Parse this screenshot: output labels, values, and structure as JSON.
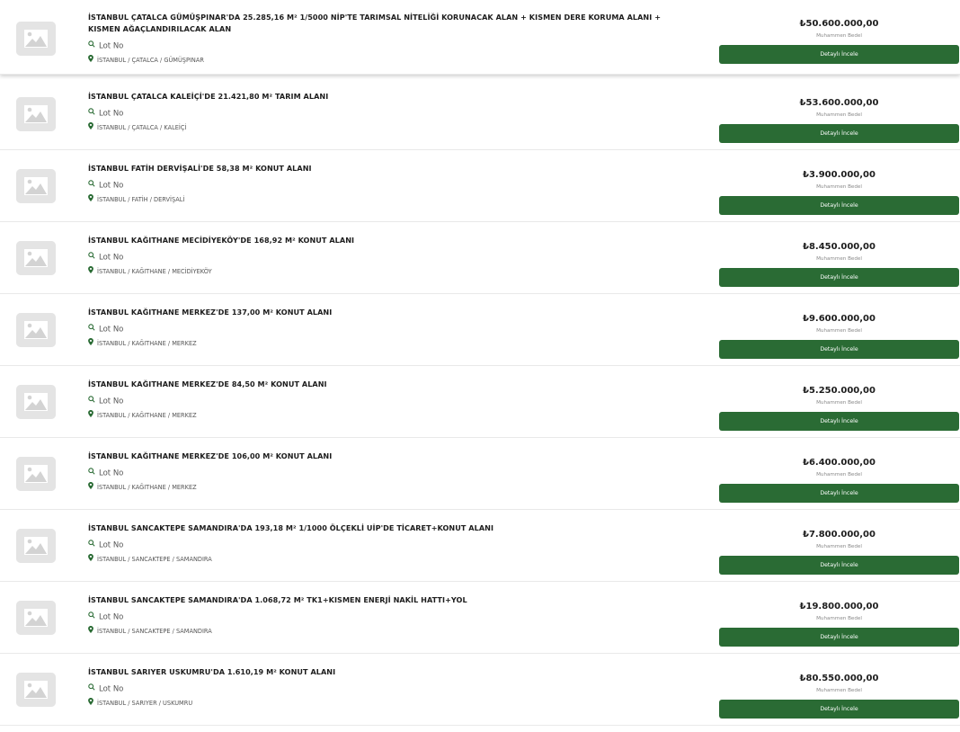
{
  "colors": {
    "button": "#2a6b34",
    "divider": "#e9e9e9",
    "thumb_bg": "#e6e6e6",
    "icon": "#2a6b34"
  },
  "icons": {
    "thumbnail": "image-placeholder-icon",
    "lot": "search-icon",
    "location": "map-pin-icon"
  },
  "listings": [
    {
      "title": "İSTANBUL ÇATALCA GÜMÜŞPINAR'DA 25.285,16 M² 1/5000 NİP'TE TARIMSAL NİTELİĞİ KORUNACAK ALAN + KISMEN DERE KORUMA ALANI + KISMEN AĞAÇLANDIRILACAK ALAN",
      "lot": "Lot No",
      "location": "İSTANBUL / ÇATALCA / GÜMÜŞPINAR",
      "price": "₺50.600.000,00",
      "price_label": "Muhammen Bedel",
      "button": "Detaylı İncele"
    },
    {
      "title": "İSTANBUL ÇATALCA KALEİÇİ'DE 21.421,80 M² TARIM ALANI",
      "lot": "Lot No",
      "location": "İSTANBUL / ÇATALCA / KALEİÇİ",
      "price": "₺53.600.000,00",
      "price_label": "Muhammen Bedel",
      "button": "Detaylı İncele"
    },
    {
      "title": "İSTANBUL FATİH DERVİŞALİ'DE 58,38 M² KONUT ALANI",
      "lot": "Lot No",
      "location": "İSTANBUL / FATİH / DERVİŞALİ",
      "price": "₺3.900.000,00",
      "price_label": "Muhammen Bedel",
      "button": "Detaylı İncele"
    },
    {
      "title": "İSTANBUL KAĞITHANE MECİDİYEKÖY'DE 168,92 M² KONUT ALANI",
      "lot": "Lot No",
      "location": "İSTANBUL / KAĞITHANE / MECİDİYEKÖY",
      "price": "₺8.450.000,00",
      "price_label": "Muhammen Bedel",
      "button": "Detaylı İncele"
    },
    {
      "title": "İSTANBUL KAĞITHANE MERKEZ'DE 137,00 M² KONUT ALANI",
      "lot": "Lot No",
      "location": "İSTANBUL / KAĞITHANE / MERKEZ",
      "price": "₺9.600.000,00",
      "price_label": "Muhammen Bedel",
      "button": "Detaylı İncele"
    },
    {
      "title": "İSTANBUL KAĞITHANE MERKEZ'DE 84,50 M² KONUT ALANI",
      "lot": "Lot No",
      "location": "İSTANBUL / KAĞITHANE / MERKEZ",
      "price": "₺5.250.000,00",
      "price_label": "Muhammen Bedel",
      "button": "Detaylı İncele"
    },
    {
      "title": "İSTANBUL KAĞITHANE MERKEZ'DE 106,00 M² KONUT ALANI",
      "lot": "Lot No",
      "location": "İSTANBUL / KAĞITHANE / MERKEZ",
      "price": "₺6.400.000,00",
      "price_label": "Muhammen Bedel",
      "button": "Detaylı İncele"
    },
    {
      "title": "İSTANBUL SANCAKTEPE SAMANDIRA'DA 193,18 M² 1/1000 ÖLÇEKLİ UİP'DE TİCARET+KONUT ALANI",
      "lot": "Lot No",
      "location": "İSTANBUL / SANCAKTEPE / SAMANDIRA",
      "price": "₺7.800.000,00",
      "price_label": "Muhammen Bedel",
      "button": "Detaylı İncele"
    },
    {
      "title": "İSTANBUL SANCAKTEPE SAMANDIRA'DA 1.068,72 M² TK1+KISMEN ENERJİ NAKİL HATTI+YOL",
      "lot": "Lot No",
      "location": "İSTANBUL / SANCAKTEPE / SAMANDIRA",
      "price": "₺19.800.000,00",
      "price_label": "Muhammen Bedel",
      "button": "Detaylı İncele"
    },
    {
      "title": "İSTANBUL SARIYER USKUMRU'DA 1.610,19 M² KONUT ALANI",
      "lot": "Lot No",
      "location": "İSTANBUL / SARIYER / USKUMRU",
      "price": "₺80.550.000,00",
      "price_label": "Muhammen Bedel",
      "button": "Detaylı İncele"
    }
  ]
}
